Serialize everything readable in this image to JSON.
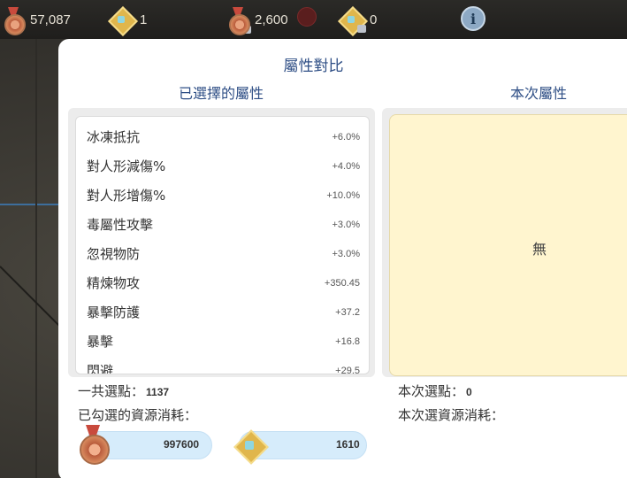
{
  "topbar": {
    "medal_count": "57,087",
    "gem_count": "1",
    "locked_medal_count": "2,600",
    "locked_gem_count": "0"
  },
  "modal": {
    "title": "屬性對比",
    "left_title": "已選擇的屬性",
    "right_title": "本次屬性",
    "attributes": [
      {
        "name": "冰凍抵抗",
        "value": "+6.0%"
      },
      {
        "name": "對人形減傷%",
        "value": "+4.0%"
      },
      {
        "name": "對人形增傷%",
        "value": "+10.0%"
      },
      {
        "name": "毒屬性攻擊",
        "value": "+3.0%"
      },
      {
        "name": "忽視物防",
        "value": "+3.0%"
      },
      {
        "name": "精煉物攻",
        "value": "+350.45"
      },
      {
        "name": "暴擊防護",
        "value": "+37.2"
      },
      {
        "name": "暴擊",
        "value": "+16.8"
      },
      {
        "name": "閃避",
        "value": "+29.5"
      }
    ],
    "current_empty_text": "無",
    "total_points_label": "一共選點：",
    "total_points_value": "1137",
    "selected_cost_label": "已勾選的資源消耗：",
    "current_points_label": "本次選點：",
    "current_points_value": "0",
    "current_cost_label": "本次選資源消耗：",
    "cost_medal_value": "997600",
    "cost_gem_value": "1610"
  }
}
